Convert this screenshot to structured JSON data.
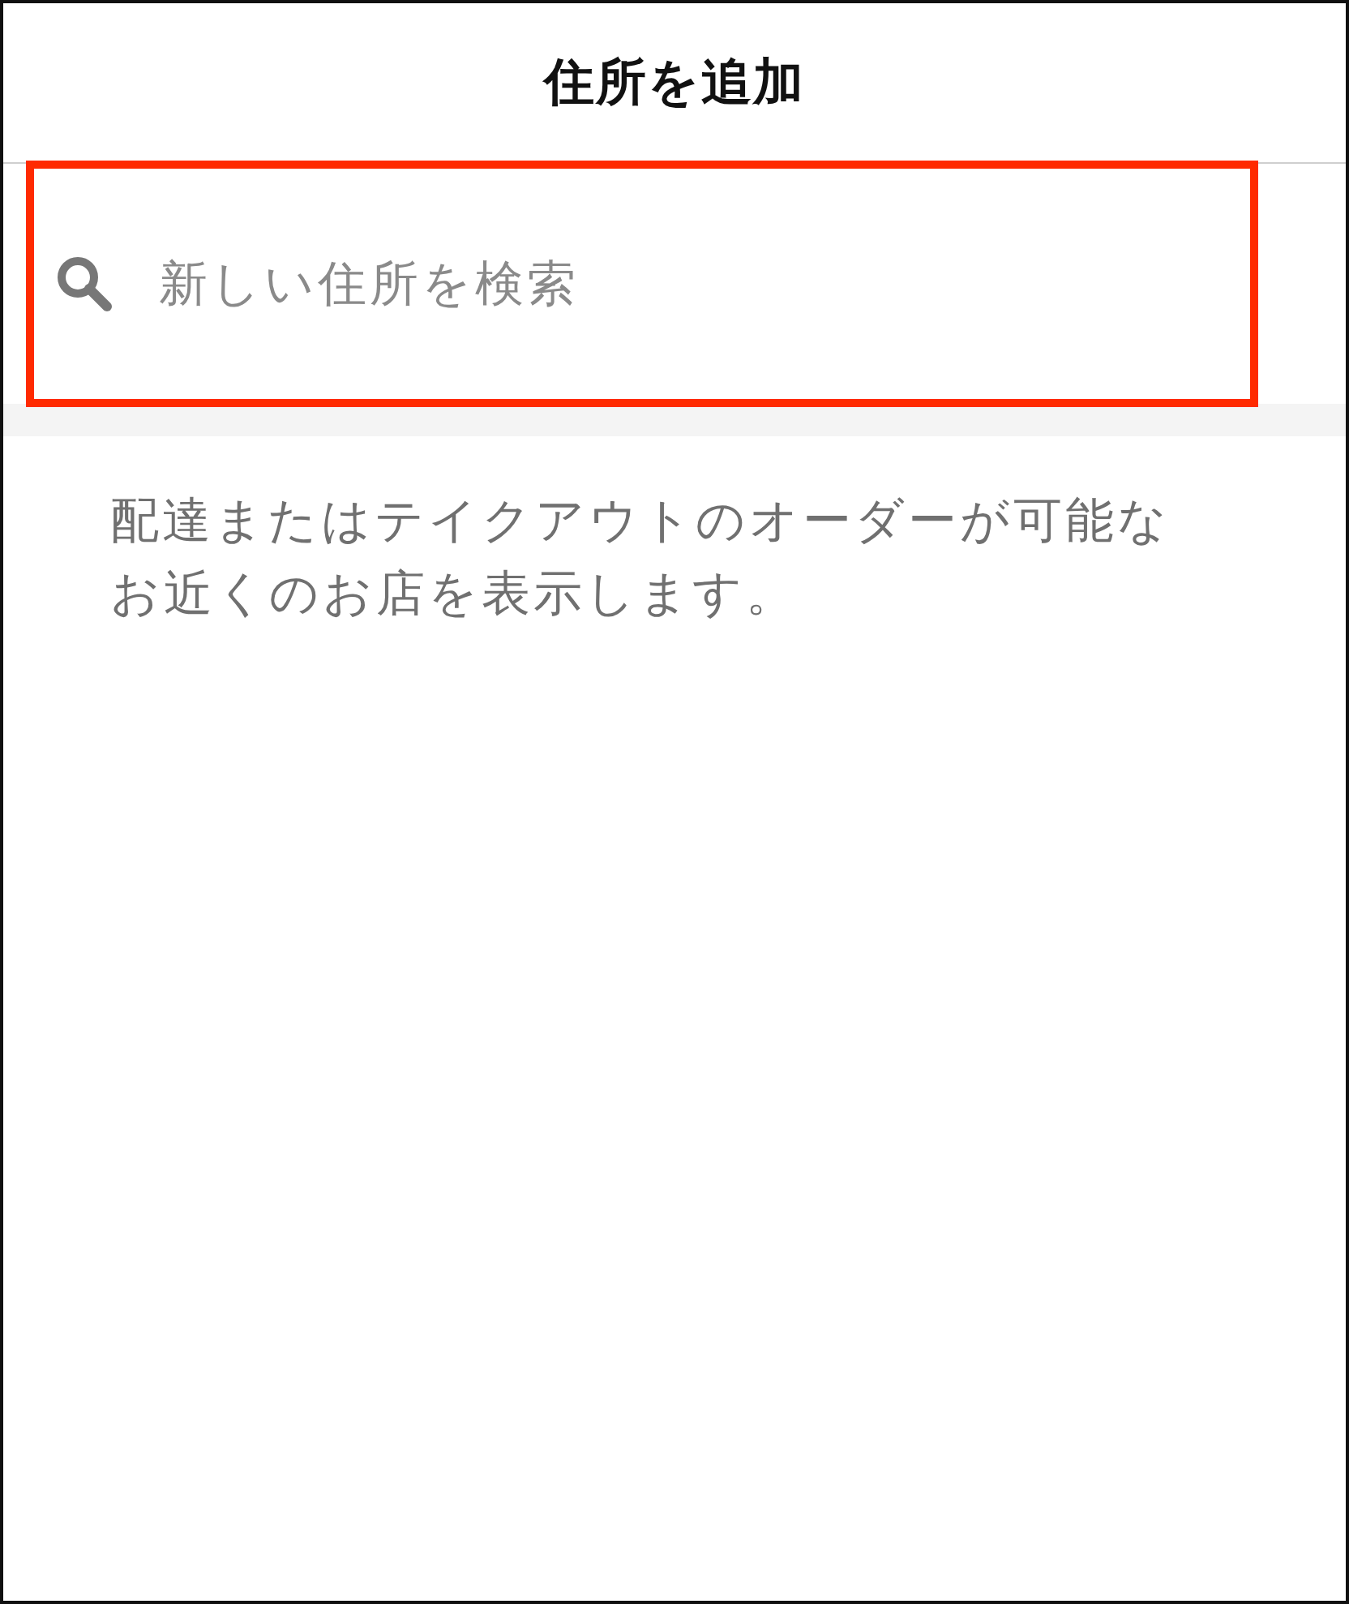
{
  "header": {
    "title": "住所を追加"
  },
  "search": {
    "placeholder": "新しい住所を検索",
    "highlighted": true
  },
  "description": "配達またはテイクアウトのオーダーが可能なお近くのお店を表示します。"
}
